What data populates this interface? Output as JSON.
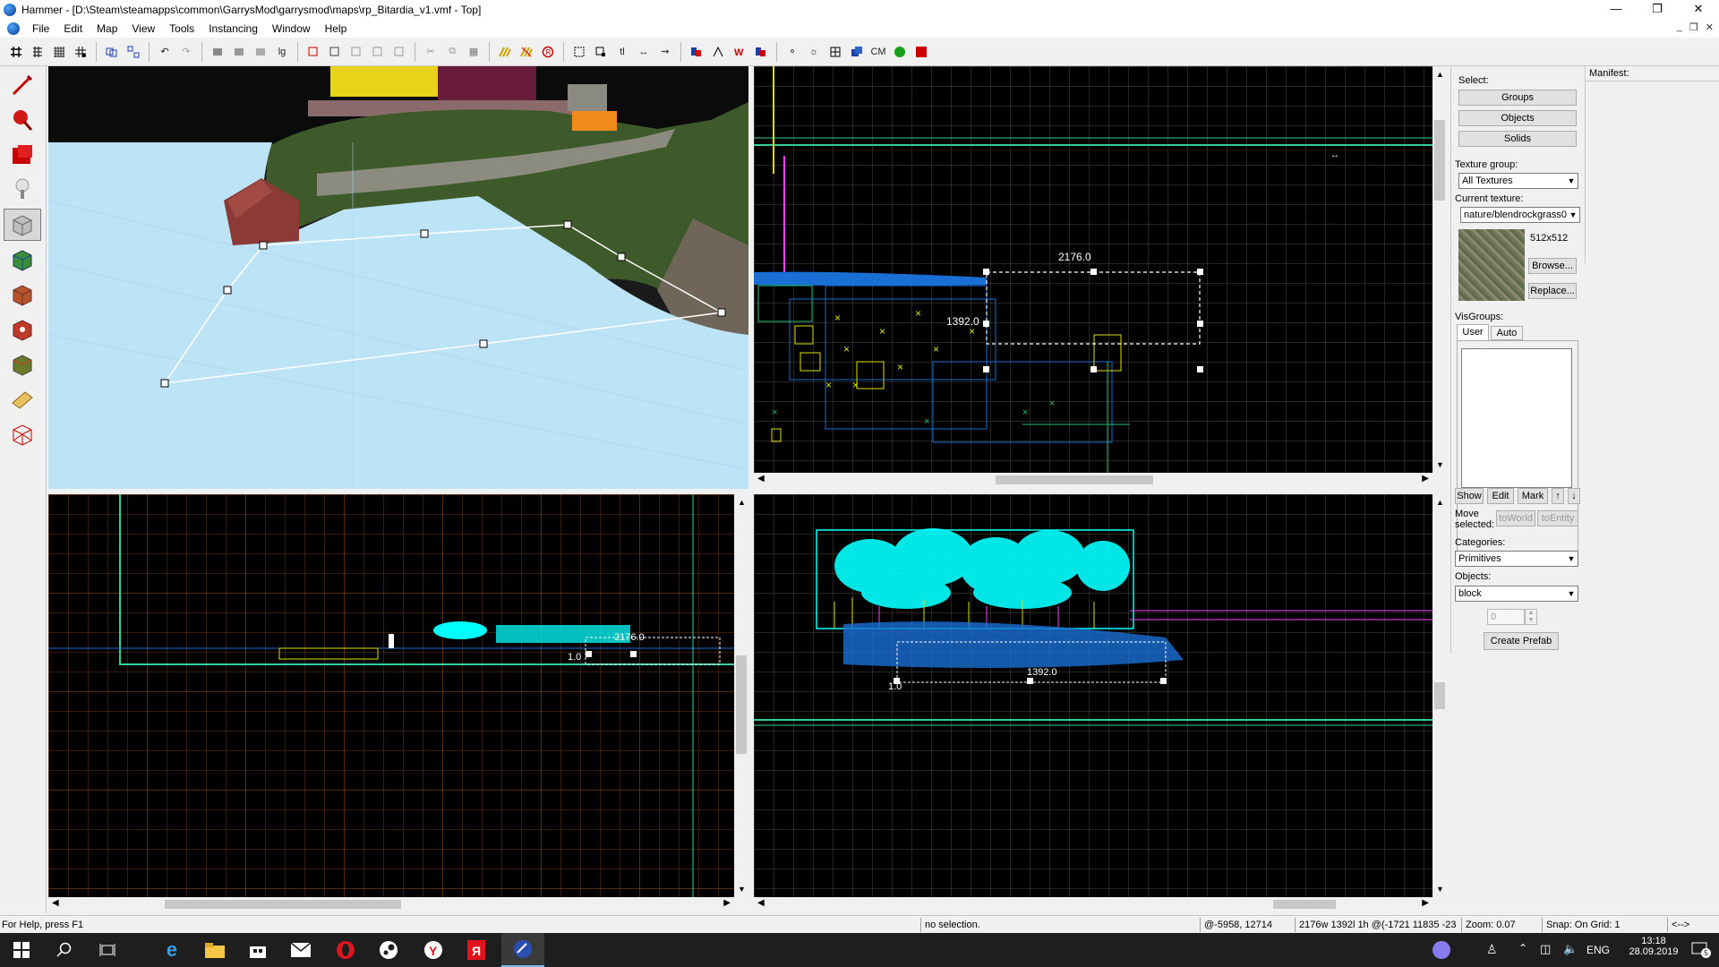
{
  "window": {
    "title": "Hammer - [D:\\Steam\\steamapps\\common\\GarrysMod\\garrysmod\\maps\\rp_Bitardia_v1.vmf - Top]",
    "min_icon": "minimize-icon",
    "max_icon": "restore-icon",
    "close_icon": "close-icon"
  },
  "menu": [
    "File",
    "Edit",
    "Map",
    "View",
    "Tools",
    "Instancing",
    "Window",
    "Help"
  ],
  "toolbar": {
    "cm_label": "CM"
  },
  "palette": [
    "selection-tool-icon",
    "magnify-tool-icon",
    "camera-tool-icon",
    "entity-tool-icon",
    "block-tool-icon",
    "texture-application-icon",
    "apply-texture-icon",
    "decal-tool-icon",
    "overlay-tool-icon",
    "clipping-tool-icon",
    "vertex-tool-icon"
  ],
  "viewports": {
    "top": {
      "dim_w": "2176.0",
      "dim_h": "1392.0"
    },
    "front": {
      "dim_w": "2176.0",
      "dim_h": "1.0"
    },
    "side": {
      "dim_w": "1392.0",
      "dim_h": "1.0"
    }
  },
  "rightpanel": {
    "select_label": "Select:",
    "groups": "Groups",
    "objects": "Objects",
    "solids": "Solids",
    "texture_group_label": "Texture group:",
    "texture_group_value": "All Textures",
    "current_texture_label": "Current texture:",
    "current_texture_value": "nature/blendrockgrass0",
    "texture_size": "512x512",
    "browse": "Browse...",
    "replace": "Replace...",
    "visgroups_label": "VisGroups:",
    "tab_user": "User",
    "tab_auto": "Auto",
    "show": "Show",
    "edit": "Edit",
    "mark": "Mark",
    "move_selected": "Move selected:",
    "to_world": "toWorld",
    "to_entity": "toEntity",
    "categories_label": "Categories:",
    "categories_value": "Primitives",
    "objects_label": "Objects:",
    "objects_value": "block",
    "stepper_value": "0",
    "create_prefab": "Create Prefab"
  },
  "manifest_label": "Manifest:",
  "status": {
    "help": "For Help, press F1",
    "selection": "no selection.",
    "coords": "@-5958, 12714",
    "size": "2176w 1392l 1h @(-1721 11835 -23",
    "zoom": "Zoom: 0.07",
    "snap": "Snap: On Grid: 1",
    "arrows": "<-->"
  },
  "taskbar": {
    "lang": "ENG",
    "time": "13:18",
    "date": "28.09.2019",
    "notif_count": "5",
    "icons": [
      "start-icon",
      "search-icon",
      "task-view-icon",
      "edge-icon",
      "explorer-icon",
      "store-icon",
      "mail-icon",
      "opera-icon",
      "steam-icon",
      "yandex-browser-icon",
      "yandex-icon",
      "hammer-icon"
    ]
  },
  "colors": {
    "grid": "#5a5a5a",
    "grid_major": "#8a4a1a",
    "water": "#bde3f7",
    "cyan": "#00ffff",
    "blue_brush": "#1a6fd4"
  }
}
